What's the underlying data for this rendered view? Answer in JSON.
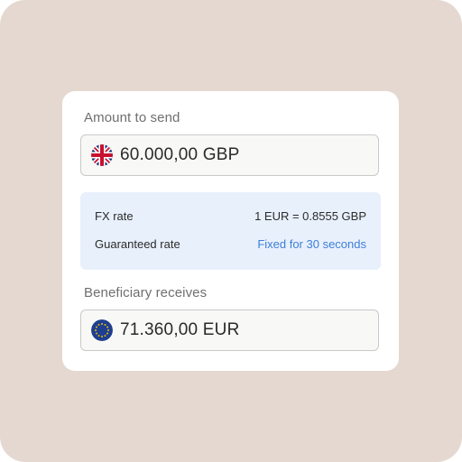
{
  "send": {
    "label": "Amount to send",
    "currency_flag": "uk-flag-icon",
    "amount": "60.000,00 GBP"
  },
  "rate_info": {
    "fx_label": "FX rate",
    "fx_value": "1 EUR = 0.8555 GBP",
    "guaranteed_label": "Guaranteed rate",
    "guaranteed_value": "Fixed for 30 seconds"
  },
  "receive": {
    "label": "Beneficiary receives",
    "currency_flag": "eu-flag-icon",
    "amount": "71.360,00 EUR"
  },
  "colors": {
    "background": "#e5d8d0",
    "card": "#ffffff",
    "rate_box": "#e8f0fc",
    "link": "#3d7fd9"
  }
}
